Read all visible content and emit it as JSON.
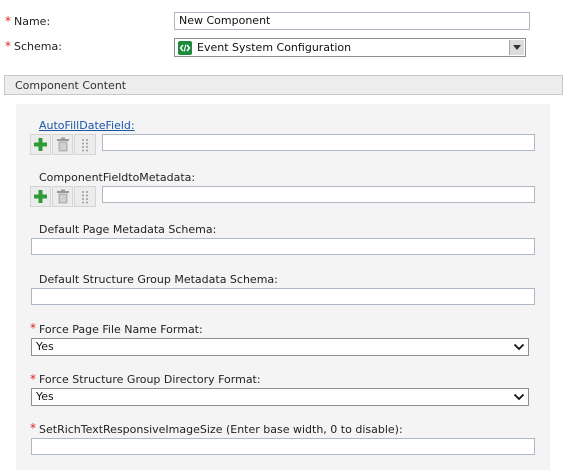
{
  "form": {
    "name_label": "Name:",
    "name_value": "New Component",
    "schema_label": "Schema:",
    "schema_value": "Event System Configuration",
    "required_mark": "*"
  },
  "section": {
    "title": "Component Content"
  },
  "fields": {
    "autofill": {
      "label": "AutoFillDateField:",
      "value": ""
    },
    "component_field": {
      "label": "ComponentFieldtoMetadata:",
      "value": ""
    },
    "page_metadata": {
      "label": "Default Page Metadata Schema:",
      "value": ""
    },
    "sg_metadata": {
      "label": "Default Structure Group Metadata Schema:",
      "value": ""
    },
    "force_page": {
      "label": "Force Page File Name Format:",
      "value": "Yes"
    },
    "force_sg": {
      "label": "Force Structure Group Directory Format:",
      "value": "Yes"
    },
    "rich_text": {
      "label": "SetRichTextResponsiveImageSize (Enter base width, 0 to disable):",
      "value": ""
    }
  },
  "icons": {
    "add": "plus-icon",
    "delete": "trash-icon",
    "drag": "drag-handle-icon",
    "schema": "schema-icon",
    "dropdown": "chevron-down-icon"
  },
  "colors": {
    "required": "#d9261c",
    "link": "#1a56a8",
    "add_icon": "#2f9b36",
    "schema_icon": "#1e8a3c"
  }
}
